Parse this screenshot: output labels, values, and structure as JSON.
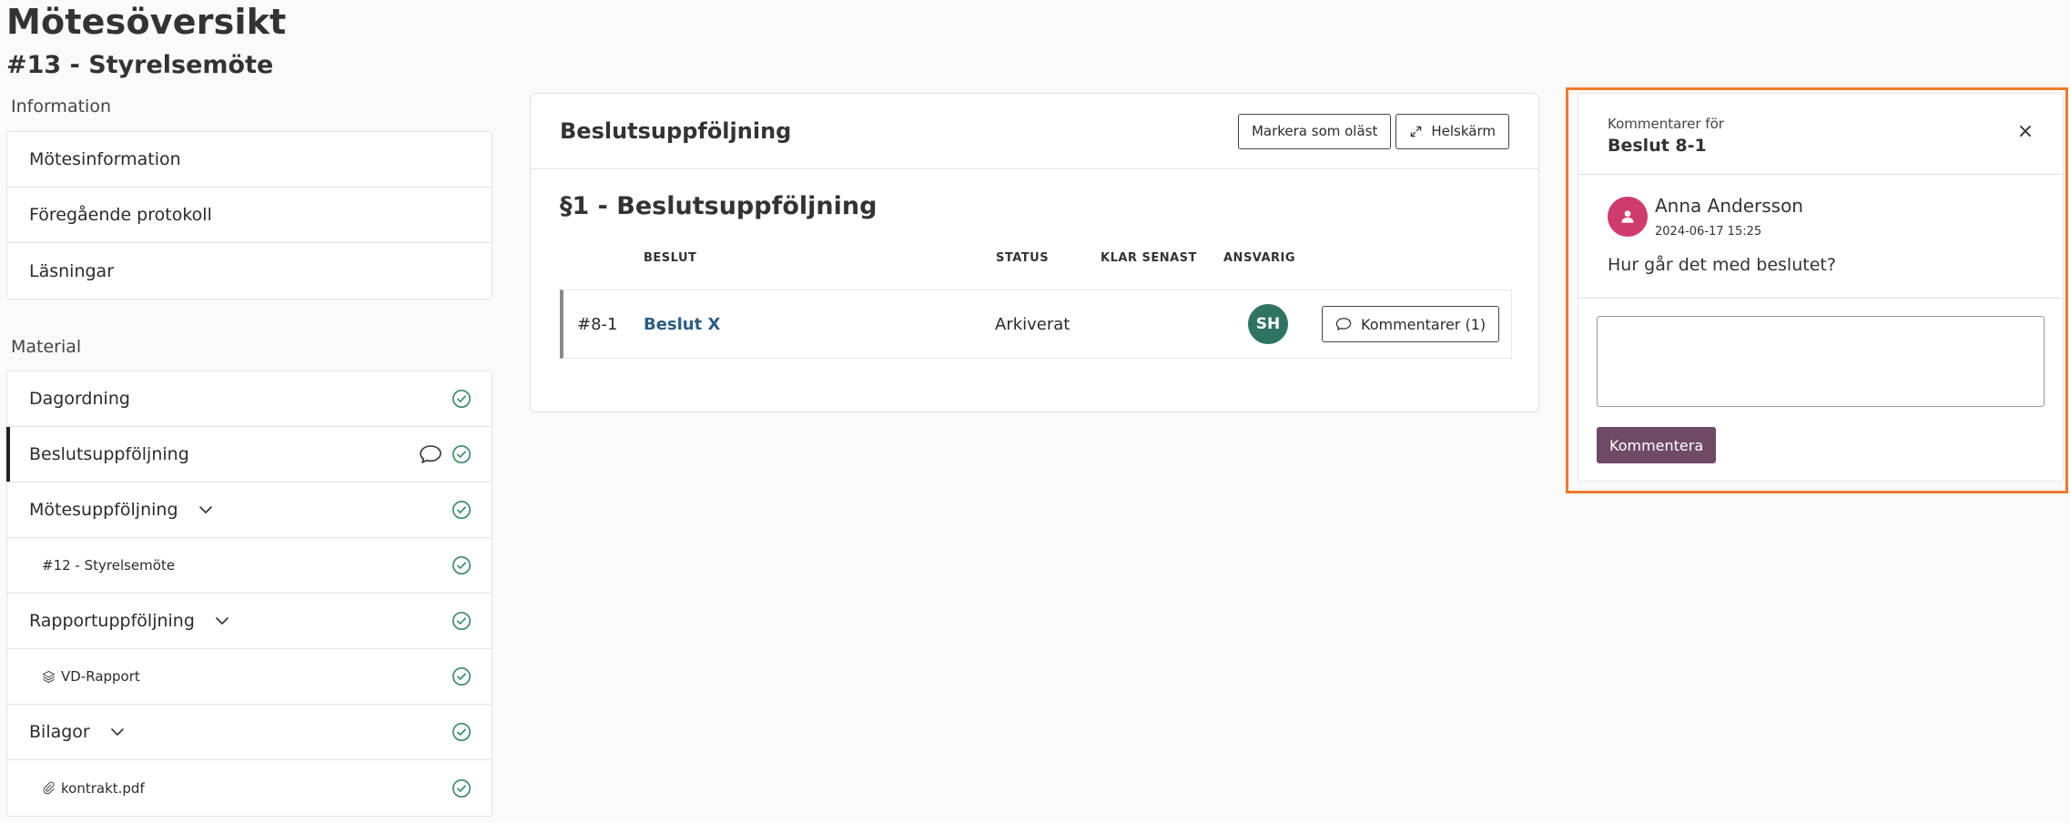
{
  "page": {
    "title": "Mötesöversikt",
    "subtitle": "#13 - Styrelsemöte"
  },
  "sidebar": {
    "information_label": "Information",
    "information_items": [
      {
        "label": "Mötesinformation"
      },
      {
        "label": "Föregående protokoll"
      },
      {
        "label": "Läsningar"
      }
    ],
    "material_label": "Material",
    "material_items": [
      {
        "label": "Dagordning",
        "icon": "check-circle-icon"
      },
      {
        "label": "Beslutsuppföljning",
        "icon": "check-circle-icon",
        "active": true,
        "has_comment": true
      },
      {
        "label": "Mötesuppföljning",
        "icon": "check-circle-icon",
        "expandable": true
      },
      {
        "label": "#12 - Styrelsemöte",
        "icon": "check-circle-icon",
        "sub": true
      },
      {
        "label": "Rapportuppföljning",
        "icon": "check-circle-icon",
        "expandable": true
      },
      {
        "label": "VD-Rapport",
        "icon": "check-circle-icon",
        "sub": true,
        "prefix_icon": "layers-icon"
      },
      {
        "label": "Bilagor",
        "icon": "check-circle-icon",
        "expandable": true
      },
      {
        "label": "kontrakt.pdf",
        "icon": "check-circle-icon",
        "sub": true,
        "prefix_icon": "paperclip-icon"
      }
    ]
  },
  "main": {
    "title": "Beslutsuppföljning",
    "mark_unread_label": "Markera som oläst",
    "fullscreen_label": "Helskärm",
    "section_heading": "§1 - Beslutsuppföljning",
    "columns": [
      "BESLUT",
      "STATUS",
      "KLAR SENAST",
      "ANSVARIG"
    ],
    "rows": [
      {
        "id": "#8-1",
        "decision": "Beslut X",
        "status": "Arkiverat",
        "deadline": "",
        "responsible": "SH",
        "comments_label": "Kommentarer (1)"
      }
    ]
  },
  "comments_panel": {
    "for_label": "Kommentarer för",
    "title": "Beslut 8-1",
    "close_label": "×",
    "comment": {
      "author": "Anna Andersson",
      "timestamp": "2024-06-17 15:25",
      "text": "Hur går det med beslutet?"
    },
    "input_value": "",
    "submit_label": "Kommentera"
  },
  "colors": {
    "accent_orange": "#ec7a2d",
    "submit_purple": "#6e4a66",
    "check_green": "#3d8b66",
    "avatar_green": "#2e7461",
    "avatar_pink": "#cf3b6d",
    "link_blue": "#2c5c85"
  }
}
